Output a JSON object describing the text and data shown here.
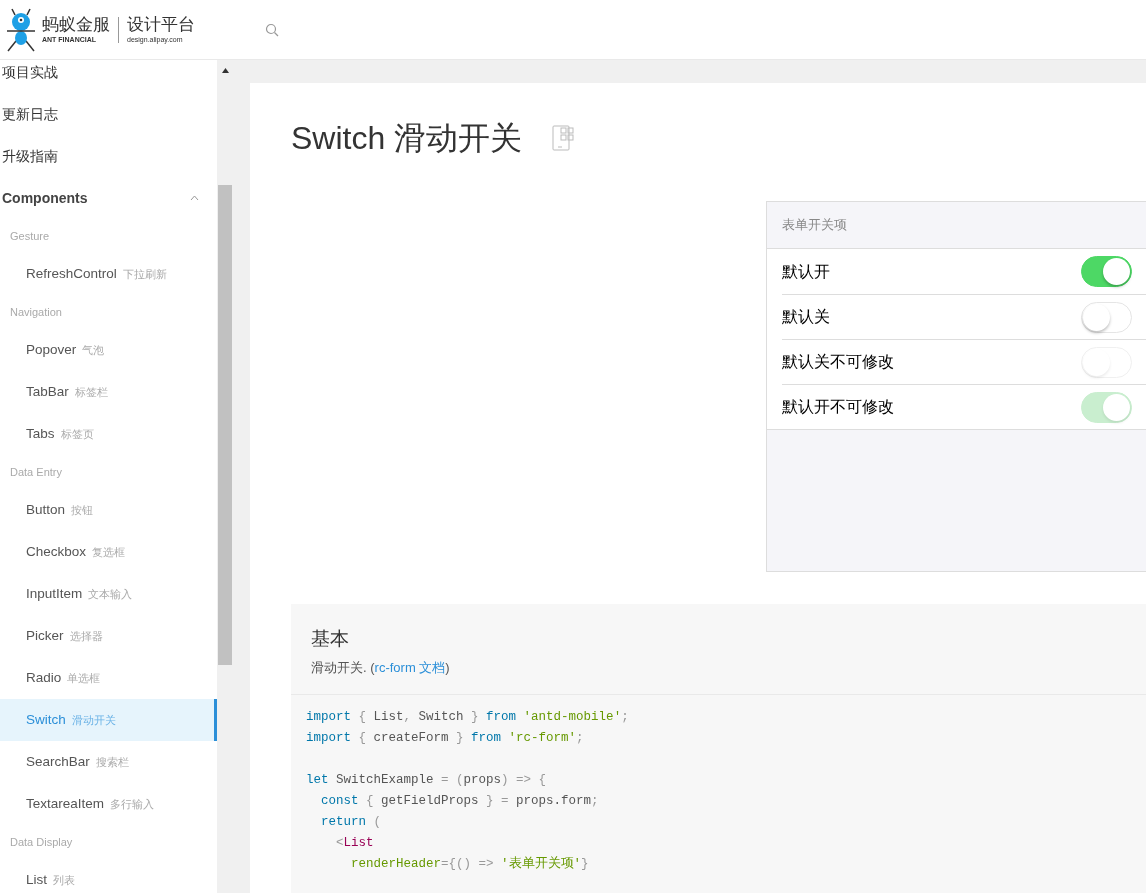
{
  "header": {
    "logo": {
      "brand_cn": "蚂蚁金服",
      "brand_en": "ANT FINANCIAL",
      "product": "设计平台",
      "domain": "design.alipay.com"
    }
  },
  "sidebar": {
    "items": [
      {
        "label": "项目实战"
      },
      {
        "label": "更新日志"
      },
      {
        "label": "升级指南"
      }
    ],
    "section": {
      "label": "Components",
      "expanded": true,
      "groups": [
        {
          "title": "Gesture",
          "items": [
            {
              "name": "RefreshControl",
              "subtitle": "下拉刷新",
              "selected": false
            }
          ]
        },
        {
          "title": "Navigation",
          "items": [
            {
              "name": "Popover",
              "subtitle": "气泡",
              "selected": false
            },
            {
              "name": "TabBar",
              "subtitle": "标签栏",
              "selected": false
            },
            {
              "name": "Tabs",
              "subtitle": "标签页",
              "selected": false
            }
          ]
        },
        {
          "title": "Data Entry",
          "items": [
            {
              "name": "Button",
              "subtitle": "按钮",
              "selected": false
            },
            {
              "name": "Checkbox",
              "subtitle": "复选框",
              "selected": false
            },
            {
              "name": "InputItem",
              "subtitle": "文本输入",
              "selected": false
            },
            {
              "name": "Picker",
              "subtitle": "选择器",
              "selected": false
            },
            {
              "name": "Radio",
              "subtitle": "单选框",
              "selected": false
            },
            {
              "name": "Switch",
              "subtitle": "滑动开关",
              "selected": true
            },
            {
              "name": "SearchBar",
              "subtitle": "搜索栏",
              "selected": false
            },
            {
              "name": "TextareaItem",
              "subtitle": "多行输入",
              "selected": false
            }
          ]
        },
        {
          "title": "Data Display",
          "items": [
            {
              "name": "List",
              "subtitle": "列表",
              "selected": false
            }
          ]
        }
      ]
    }
  },
  "page": {
    "title": "Switch 滑动开关"
  },
  "preview": {
    "header": "表单开关项",
    "rows": [
      {
        "label": "默认开",
        "checked": true,
        "disabled": false
      },
      {
        "label": "默认关",
        "checked": false,
        "disabled": false
      },
      {
        "label": "默认关不可修改",
        "checked": false,
        "disabled": true
      },
      {
        "label": "默认开不可修改",
        "checked": true,
        "disabled": true
      }
    ]
  },
  "demo": {
    "title": "基本",
    "description": "滑动开关. ",
    "link": "rc-form 文档",
    "paren_open": "(",
    "paren_close": ")",
    "code": [
      [
        {
          "kind": "keyword",
          "text": "import"
        },
        {
          "kind": "punct",
          "text": " { "
        },
        {
          "kind": "plain",
          "text": "List"
        },
        {
          "kind": "punct",
          "text": ", "
        },
        {
          "kind": "plain",
          "text": "Switch"
        },
        {
          "kind": "punct",
          "text": " } "
        },
        {
          "kind": "keyword",
          "text": "from"
        },
        {
          "kind": "string",
          "text": " 'antd-mobile'"
        },
        {
          "kind": "punct",
          "text": ";"
        }
      ],
      [
        {
          "kind": "keyword",
          "text": "import"
        },
        {
          "kind": "punct",
          "text": " { "
        },
        {
          "kind": "plain",
          "text": "createForm"
        },
        {
          "kind": "punct",
          "text": " } "
        },
        {
          "kind": "keyword",
          "text": "from"
        },
        {
          "kind": "string",
          "text": " 'rc-form'"
        },
        {
          "kind": "punct",
          "text": ";"
        }
      ],
      [
        {
          "kind": "gap"
        },
        {
          "kind": "keyword",
          "text": "let"
        },
        {
          "kind": "plain",
          "text": " SwitchExample "
        },
        {
          "kind": "punct",
          "text": "= ("
        },
        {
          "kind": "plain",
          "text": "props"
        },
        {
          "kind": "punct",
          "text": ") => {"
        }
      ],
      [
        {
          "kind": "keyword",
          "text": "  const"
        },
        {
          "kind": "punct",
          "text": " { "
        },
        {
          "kind": "plain",
          "text": "getFieldProps"
        },
        {
          "kind": "punct",
          "text": " } = "
        },
        {
          "kind": "plain",
          "text": "props.form"
        },
        {
          "kind": "punct",
          "text": ";"
        }
      ],
      [
        {
          "kind": "keyword",
          "text": "  return"
        },
        {
          "kind": "punct",
          "text": " ("
        }
      ],
      [
        {
          "kind": "punct",
          "text": "    <"
        },
        {
          "kind": "tag",
          "text": "List"
        }
      ],
      [
        {
          "kind": "attr",
          "text": "      renderHeader"
        },
        {
          "kind": "punct",
          "text": "={() => "
        },
        {
          "kind": "string",
          "text": "'表单开关项'"
        },
        {
          "kind": "punct",
          "text": "}"
        }
      ]
    ]
  }
}
